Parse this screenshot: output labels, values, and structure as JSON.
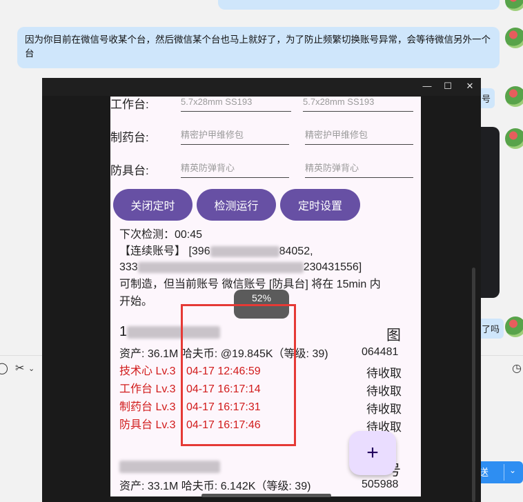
{
  "chat": {
    "message": "因为你目前在微信号收某个台，然后微信某个台也马上就好了，为了防止频繁切换账号异常，会等待微信另外一个台",
    "side_fragment_1": "号",
    "side_fragment_2": "了吗",
    "send_label": "送"
  },
  "form": {
    "rows": [
      {
        "label": "工作台:",
        "value1": "5.7x28mm SS193",
        "value2": "5.7x28mm SS193"
      },
      {
        "label": "制药台:",
        "value1": "精密护甲维修包",
        "value2": "精密护甲维修包"
      },
      {
        "label": "防具台:",
        "value1": "精英防弹背心",
        "value2": "精英防弹背心"
      }
    ]
  },
  "buttons": {
    "close_timer": "关闭定时",
    "check_run": "检测运行",
    "timer_settings": "定时设置"
  },
  "status": {
    "next_check_label": "下次检测：00:45",
    "linked_prefix": "【连续账号】 [396",
    "linked_part2": "84052,",
    "line2_prefix": "333",
    "line2_suffix": "230431556]",
    "message_line1": "可制造，但当前账号 微信账号 [防具台] 将在 15min 内",
    "message_line2": "开始。"
  },
  "toast": "52%",
  "accounts": [
    {
      "name_prefix": "1",
      "right_label": "图",
      "assets": "资产: 36.1M 哈夫币: @19.845K（等级: 39)",
      "id_suffix": "064481",
      "timers": [
        {
          "station": "技术心 Lv.3",
          "time": "04-17 12:46:59",
          "status": "待收取"
        },
        {
          "station": "工作台 Lv.3",
          "time": "04-17 16:17:14",
          "status": "待收取"
        },
        {
          "station": "制药台 Lv.3",
          "time": "04-17 16:17:31",
          "status": "待收取"
        },
        {
          "station": "防具台 Lv.3",
          "time": "04-17 16:17:46",
          "status": "待收取"
        }
      ]
    },
    {
      "right_label": "号",
      "assets": "资产: 33.1M 哈夫币: 6.142K（等级: 39)",
      "id_suffix": "505988"
    }
  ],
  "fab_symbol": "+",
  "colors": {
    "accent": "#6750a4",
    "timer_red": "#d11a1a",
    "highlight": "#e53935",
    "chat_bubble": "#cfe6fb"
  },
  "icons": [
    "scissors-icon",
    "chevron-down-icon",
    "clock-icon",
    "plus-icon",
    "minimize-icon",
    "maximize-icon",
    "close-icon",
    "avatar"
  ]
}
